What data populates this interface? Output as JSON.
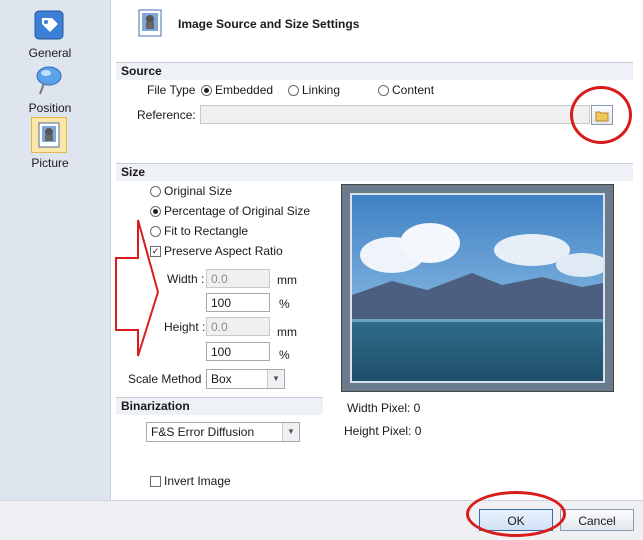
{
  "nav": {
    "items": [
      {
        "label": "General",
        "icon": "tag-icon"
      },
      {
        "label": "Position",
        "icon": "pin-icon"
      },
      {
        "label": "Picture",
        "icon": "picture-icon",
        "active": true
      }
    ]
  },
  "header": {
    "title": "Image Source and Size Settings"
  },
  "source": {
    "heading": "Source",
    "file_type_label": "File Type",
    "options": [
      "Embedded",
      "Linking",
      "Content"
    ],
    "selected": "Embedded",
    "reference_label": "Reference:",
    "reference_value": ""
  },
  "size": {
    "heading": "Size",
    "options": [
      "Original Size",
      "Percentage of Original Size",
      "Fit to Rectangle"
    ],
    "selected": "Percentage of Original Size",
    "preserve_aspect_label": "Preserve Aspect Ratio",
    "preserve_aspect_checked": true,
    "width_label": "Width :",
    "width_value": "0.0",
    "width_unit": "mm",
    "width_percent": "100",
    "height_label": "Height :",
    "height_value": "0.0",
    "height_unit": "mm",
    "height_percent": "100",
    "percent_unit": "%",
    "scale_method_label": "Scale Method :",
    "scale_method_value": "Box"
  },
  "binarization": {
    "heading": "Binarization",
    "method_value": "F&S Error Diffusion",
    "invert_label": "Invert Image",
    "invert_checked": false
  },
  "preview": {
    "width_pixel_label": "Width Pixel: 0",
    "height_pixel_label": "Height Pixel: 0"
  },
  "footer": {
    "ok_label": "OK",
    "cancel_label": "Cancel"
  },
  "colors": {
    "annotation_red": "#d81c1c",
    "nav_bg": "#dfe5ee"
  }
}
